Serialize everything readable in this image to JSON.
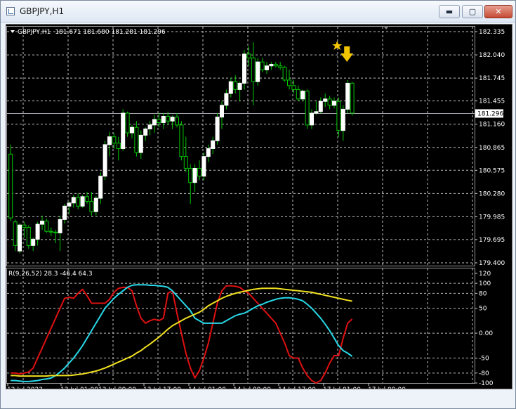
{
  "window": {
    "title": "GBPJPY,H1",
    "controls": {
      "minimize": "▬",
      "maximize": "▢",
      "close": "✕"
    }
  },
  "main_panel": {
    "header": {
      "symbol": "GBPJPY,H1",
      "ohlc": "181.671 181.680 181.281 181.296"
    },
    "price_labels": [
      "182.335",
      "182.040",
      "181.745",
      "181.455",
      "181.160",
      "180.865",
      "180.575",
      "180.280",
      "179.985",
      "179.695",
      "179.400"
    ],
    "current_price": "181.296"
  },
  "indicator_panel": {
    "header": "R(9,26,52) 28.3 -46.4 64.3",
    "scale_labels": [
      "120",
      "100",
      "80",
      "50",
      "0.00",
      "-50",
      "-80",
      "-100"
    ]
  },
  "time_labels": [
    "12 Jul 2023",
    "13 Jul 01:00",
    "13 Jul 09:00",
    "13 Jul 17:00",
    "14 Jul 01:00",
    "14 Jul 09:00",
    "14 Jul 17:00",
    "17 Jul 01:00",
    "17 Jul 09:00"
  ],
  "colors": {
    "background": "#000000",
    "grid": "#c0c0c0",
    "candle": "#ffffff",
    "wick": "#00c800",
    "fast_line": "#e01010",
    "mid_line": "#28d8e8",
    "slow_line": "#f0e020",
    "signal_arrow": "#f2c500",
    "signal_star": "#f2c500"
  },
  "icons": {
    "signal_arrow": "down-arrow-icon",
    "signal_star": "star-icon",
    "menu_marker": "triangle-down-icon"
  },
  "chart_data": [
    {
      "type": "candlestick",
      "title": "GBPJPY,H1",
      "ylim": [
        179.4,
        182.335
      ],
      "y_ticks": [
        182.335,
        182.04,
        181.745,
        181.455,
        181.16,
        180.865,
        180.575,
        180.28,
        179.985,
        179.695,
        179.4
      ],
      "current_price": 181.296,
      "ohlc": [
        [
          180.78,
          180.9,
          179.93,
          179.97
        ],
        [
          179.92,
          179.95,
          179.55,
          179.62
        ],
        [
          179.55,
          179.9,
          179.52,
          179.88
        ],
        [
          179.88,
          179.92,
          179.72,
          179.85
        ],
        [
          179.85,
          179.88,
          179.58,
          179.62
        ],
        [
          179.62,
          179.72,
          179.55,
          179.7
        ],
        [
          179.7,
          179.92,
          179.62,
          179.89
        ],
        [
          179.89,
          180.0,
          179.82,
          179.93
        ],
        [
          179.93,
          179.96,
          179.78,
          179.8
        ],
        [
          179.8,
          179.85,
          179.74,
          179.79
        ],
        [
          179.79,
          179.82,
          179.65,
          179.78
        ],
        [
          179.78,
          180.0,
          179.55,
          179.95
        ],
        [
          179.95,
          180.15,
          179.9,
          180.12
        ],
        [
          180.12,
          180.18,
          180.02,
          180.16
        ],
        [
          180.16,
          180.26,
          180.1,
          180.23
        ],
        [
          180.23,
          180.28,
          180.08,
          180.12
        ],
        [
          180.12,
          180.26,
          180.1,
          180.24
        ],
        [
          180.24,
          180.3,
          180.15,
          180.18
        ],
        [
          180.18,
          180.3,
          180.0,
          180.05
        ],
        [
          180.05,
          180.25,
          180.0,
          180.22
        ],
        [
          180.22,
          180.55,
          180.15,
          180.5
        ],
        [
          180.5,
          180.95,
          180.45,
          180.9
        ],
        [
          180.9,
          181.06,
          180.75,
          181.0
        ],
        [
          181.0,
          181.05,
          180.85,
          180.92
        ],
        [
          180.92,
          181.0,
          180.7,
          180.85
        ],
        [
          180.85,
          181.35,
          180.82,
          181.3
        ],
        [
          181.3,
          181.32,
          181.0,
          181.05
        ],
        [
          181.05,
          181.15,
          180.98,
          181.12
        ],
        [
          181.12,
          181.2,
          180.75,
          180.8
        ],
        [
          180.8,
          181.08,
          180.72,
          181.02
        ],
        [
          181.02,
          181.12,
          180.95,
          181.1
        ],
        [
          181.1,
          181.2,
          181.02,
          181.15
        ],
        [
          181.15,
          181.28,
          181.05,
          181.22
        ],
        [
          181.22,
          181.3,
          181.12,
          181.18
        ],
        [
          181.18,
          181.3,
          181.1,
          181.26
        ],
        [
          181.26,
          181.32,
          181.15,
          181.2
        ],
        [
          181.2,
          181.27,
          181.1,
          181.25
        ],
        [
          181.25,
          181.3,
          181.12,
          181.15
        ],
        [
          181.15,
          181.2,
          180.7,
          180.75
        ],
        [
          180.75,
          181.0,
          180.55,
          180.6
        ],
        [
          180.6,
          180.65,
          180.15,
          180.42
        ],
        [
          180.42,
          180.65,
          180.3,
          180.6
        ],
        [
          180.6,
          180.7,
          180.45,
          180.5
        ],
        [
          180.5,
          180.8,
          180.45,
          180.75
        ],
        [
          180.75,
          180.9,
          180.68,
          180.85
        ],
        [
          180.85,
          181.0,
          180.78,
          180.95
        ],
        [
          180.95,
          181.3,
          180.9,
          181.25
        ],
        [
          181.25,
          181.45,
          181.1,
          181.4
        ],
        [
          181.4,
          181.6,
          181.35,
          181.55
        ],
        [
          181.55,
          181.75,
          181.5,
          181.7
        ],
        [
          181.7,
          181.78,
          181.55,
          181.6
        ],
        [
          181.6,
          181.7,
          181.45,
          181.68
        ],
        [
          181.68,
          182.1,
          181.6,
          182.05
        ],
        [
          182.05,
          182.15,
          181.9,
          182.0
        ],
        [
          182.0,
          182.2,
          181.4,
          181.7
        ],
        [
          181.7,
          182.0,
          181.65,
          181.95
        ],
        [
          181.95,
          182.0,
          181.82,
          181.85
        ],
        [
          181.85,
          181.95,
          181.8,
          181.9
        ],
        [
          181.9,
          181.95,
          181.85,
          181.92
        ],
        [
          181.92,
          181.95,
          181.88,
          181.9
        ],
        [
          181.9,
          181.95,
          181.85,
          181.88
        ],
        [
          181.88,
          181.9,
          181.7,
          181.72
        ],
        [
          181.72,
          181.85,
          181.6,
          181.65
        ],
        [
          181.65,
          181.72,
          181.55,
          181.6
        ],
        [
          181.6,
          181.65,
          181.45,
          181.48
        ],
        [
          181.48,
          181.6,
          181.45,
          181.58
        ],
        [
          181.58,
          181.6,
          181.1,
          181.15
        ],
        [
          181.15,
          181.35,
          181.1,
          181.3
        ],
        [
          181.3,
          181.45,
          181.28,
          181.32
        ],
        [
          181.32,
          181.5,
          181.3,
          181.45
        ],
        [
          181.45,
          181.55,
          181.38,
          181.48
        ],
        [
          181.48,
          181.52,
          181.35,
          181.4
        ],
        [
          181.4,
          181.5,
          181.36,
          181.45
        ],
        [
          181.45,
          181.5,
          181.0,
          181.08
        ],
        [
          181.08,
          181.4,
          180.95,
          181.35
        ],
        [
          181.35,
          181.72,
          181.3,
          181.68
        ],
        [
          181.68,
          181.7,
          181.27,
          181.3
        ]
      ]
    },
    {
      "type": "line",
      "title": "R(9,26,52) 28.3 -46.4 64.3",
      "ylim": [
        -100,
        120
      ],
      "y_ticks": [
        120,
        100,
        80,
        50,
        0,
        -50,
        -80,
        -100
      ],
      "series": [
        {
          "values": [
            -80,
            -80,
            -82,
            -80,
            -78,
            -70,
            -50,
            -30,
            -10,
            10,
            30,
            50,
            70,
            72,
            70,
            80,
            88,
            75,
            60,
            60,
            60,
            60,
            68,
            82,
            90,
            92,
            92,
            85,
            55,
            30,
            20,
            25,
            28,
            25,
            30,
            80,
            85,
            40,
            0,
            -40,
            -70,
            -90,
            -75,
            -50,
            -20,
            20,
            60,
            85,
            95,
            95,
            94,
            92,
            85,
            80,
            70,
            60,
            50,
            40,
            30,
            20,
            0,
            -20,
            -45,
            -50,
            -50,
            -70,
            -85,
            -95,
            -100,
            -95,
            -80,
            -60,
            -45,
            -45,
            -10,
            20,
            28.3
          ]
        },
        {
          "values": [
            -95,
            -95,
            -96,
            -97,
            -97,
            -96,
            -95,
            -93,
            -92,
            -90,
            -85,
            -78,
            -70,
            -60,
            -50,
            -38,
            -25,
            -10,
            5,
            20,
            35,
            50,
            60,
            70,
            78,
            85,
            92,
            96,
            97,
            97,
            97,
            96,
            96,
            95,
            94,
            92,
            85,
            75,
            65,
            55,
            45,
            30,
            25,
            20,
            20,
            20,
            20,
            20,
            25,
            30,
            35,
            38,
            40,
            45,
            50,
            55,
            58,
            62,
            65,
            68,
            70,
            71,
            71,
            70,
            68,
            65,
            58,
            50,
            40,
            30,
            18,
            5,
            -10,
            -25,
            -35,
            -40,
            -46.4
          ]
        },
        {
          "values": [
            -85,
            -85,
            -86,
            -86,
            -86,
            -86,
            -86,
            -86,
            -86,
            -85,
            -85,
            -85,
            -85,
            -85,
            -84,
            -83,
            -82,
            -80,
            -78,
            -76,
            -73,
            -70,
            -66,
            -62,
            -58,
            -54,
            -50,
            -46,
            -40,
            -35,
            -28,
            -22,
            -15,
            -8,
            0,
            8,
            15,
            20,
            25,
            30,
            34,
            38,
            42,
            48,
            55,
            60,
            65,
            70,
            74,
            77,
            80,
            82,
            84,
            86,
            88,
            89,
            90,
            90,
            90,
            90,
            89,
            88,
            87,
            86,
            85,
            84,
            83,
            82,
            80,
            78,
            76,
            74,
            72,
            70,
            68,
            66,
            64.3
          ]
        }
      ]
    }
  ]
}
